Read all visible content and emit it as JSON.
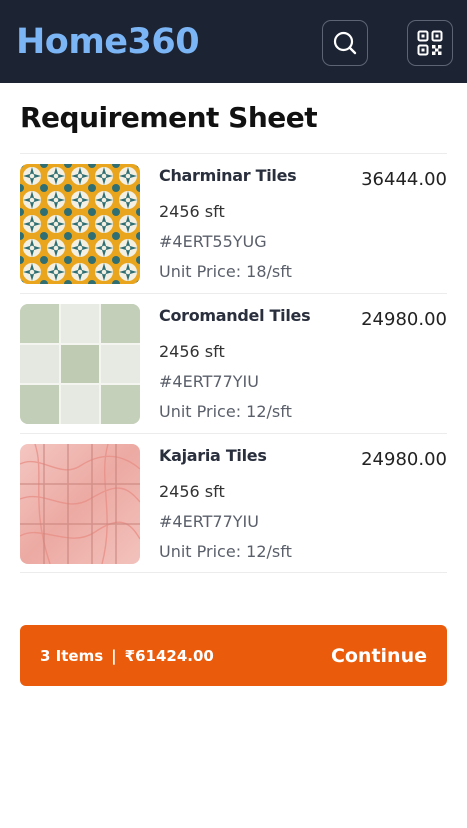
{
  "app": {
    "title": "Home360"
  },
  "header": {
    "search_icon": "search-icon",
    "qr_icon": "qr-code-icon"
  },
  "page": {
    "title": "Requirement Sheet"
  },
  "items": [
    {
      "name": "Charminar Tiles",
      "price": "36444.00",
      "quantity": "2456 sft",
      "code": "#4ERT55YUG",
      "unit_price": "Unit Price: 18/sft"
    },
    {
      "name": "Coromandel Tiles",
      "price": "24980.00",
      "quantity": "2456 sft",
      "code": "#4ERT77YIU",
      "unit_price": "Unit Price: 12/sft"
    },
    {
      "name": "Kajaria Tiles",
      "price": "24980.00",
      "quantity": "2456 sft",
      "code": "#4ERT77YIU",
      "unit_price": "Unit Price: 12/sft"
    }
  ],
  "cart": {
    "items_count": "3 Items",
    "separator": "|",
    "total": "₹61424.00",
    "action": "Continue"
  },
  "colors": {
    "header_bg": "#1c2333",
    "brand": "#7bb5f5",
    "accent": "#ea5b0c"
  }
}
